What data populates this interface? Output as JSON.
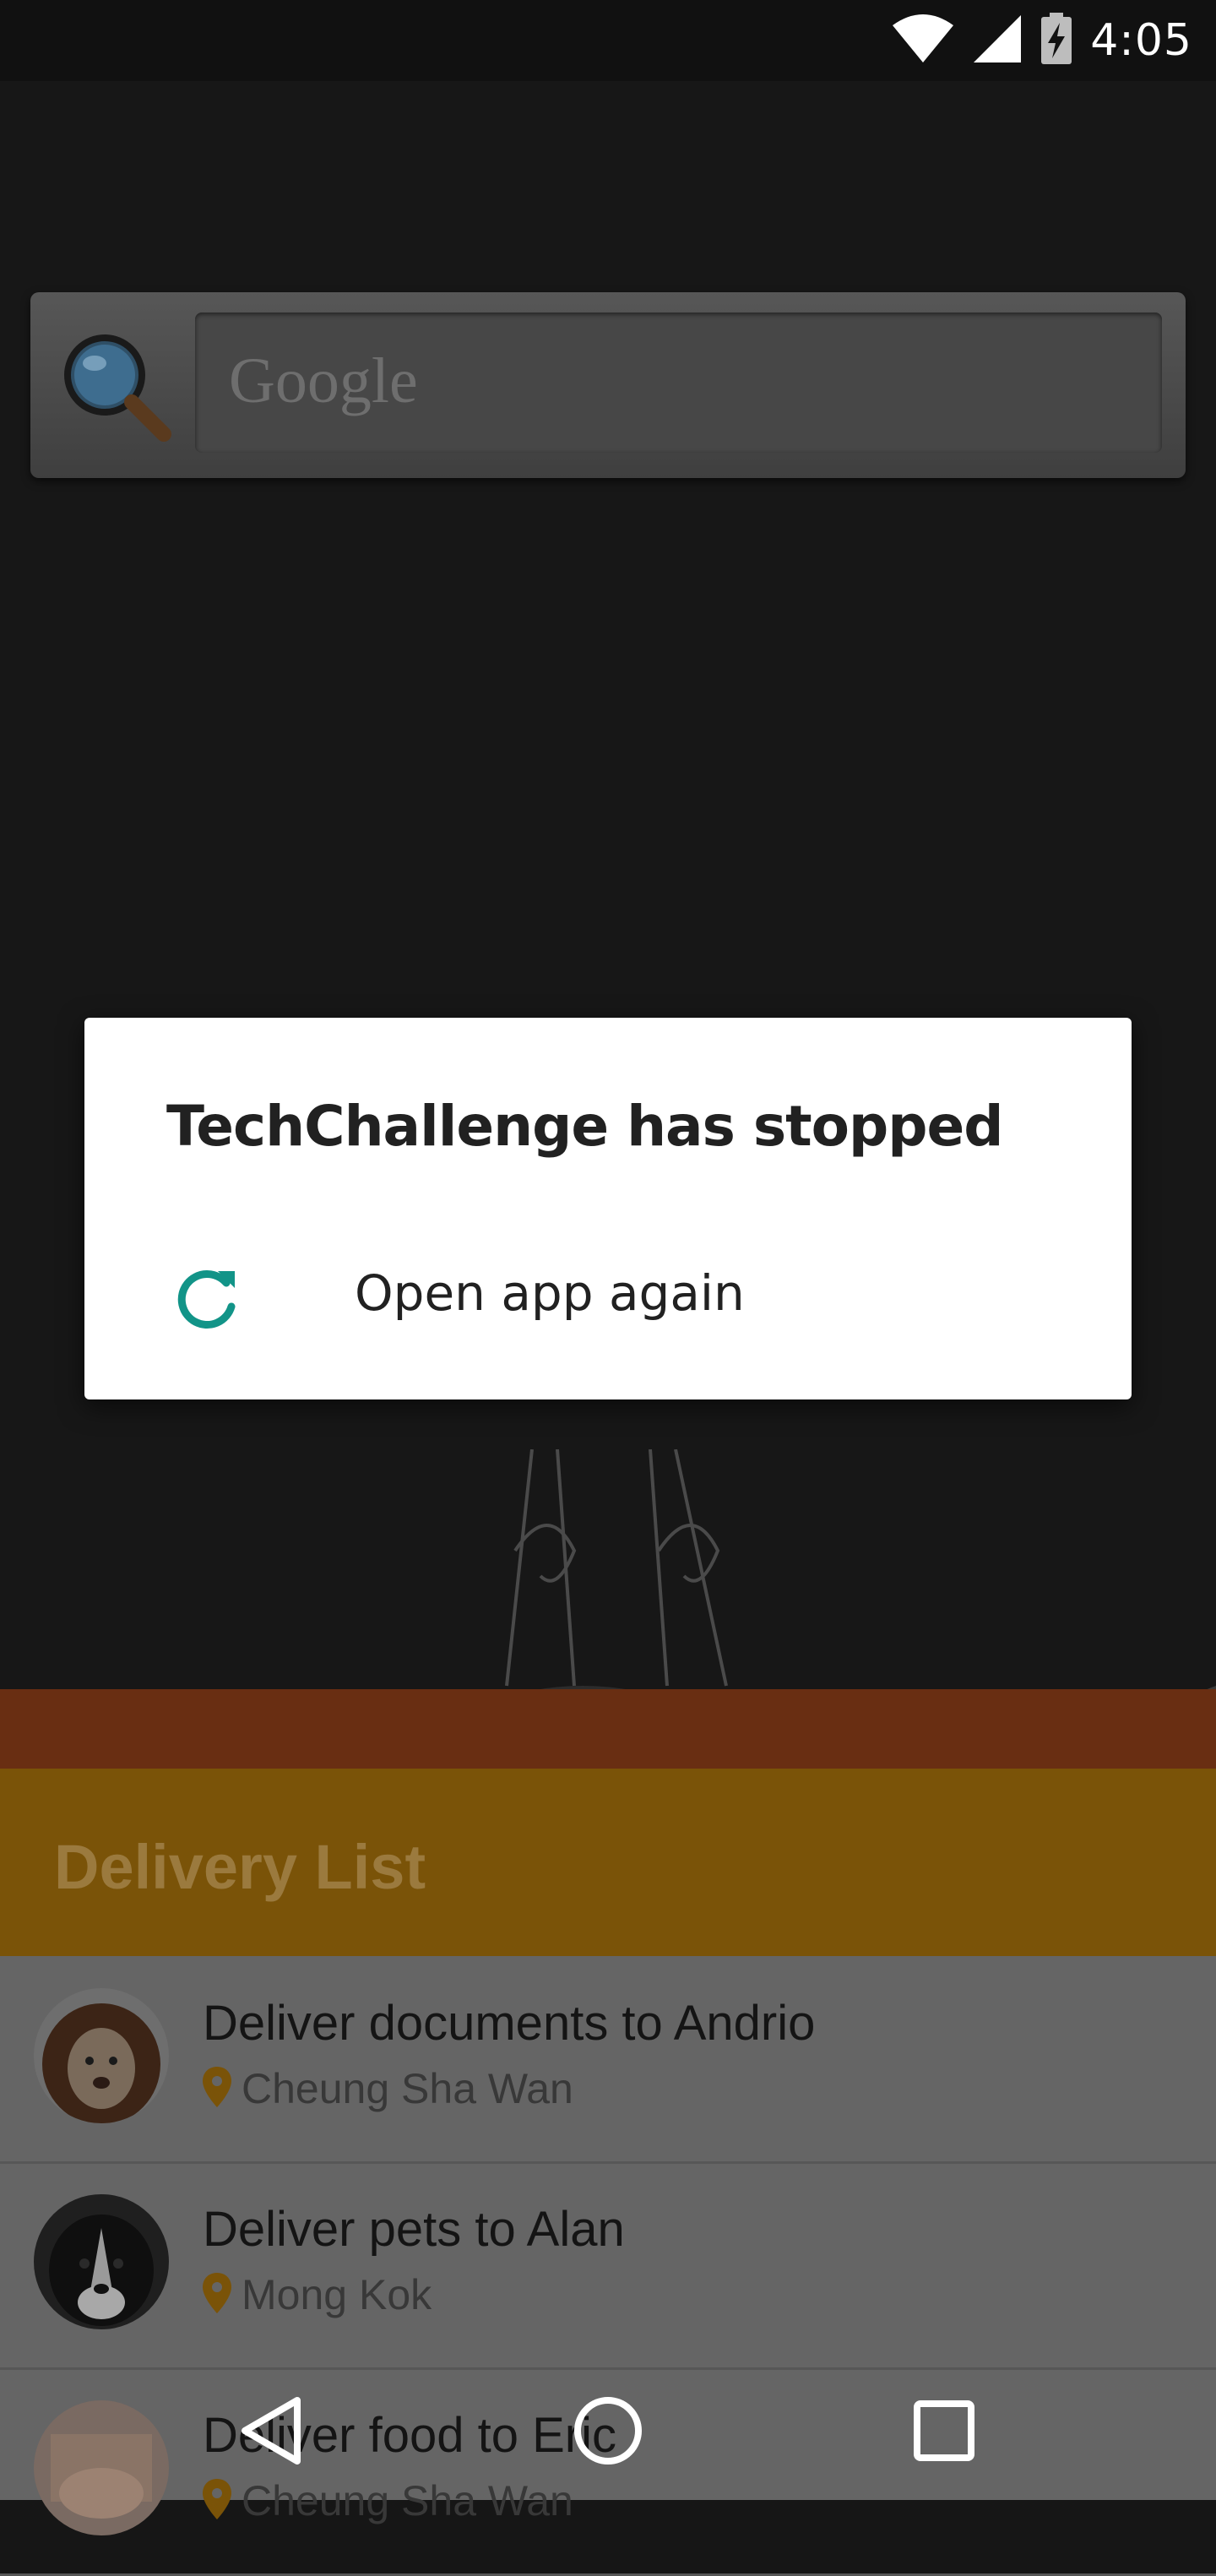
{
  "status_bar": {
    "time": "4:05",
    "icons": [
      "wifi-icon",
      "cell-signal-icon",
      "battery-charging-icon"
    ]
  },
  "launcher": {
    "search_placeholder": "Google"
  },
  "app": {
    "header_title": "Delivery List",
    "deliveries": [
      {
        "title": "Deliver documents to Andrio",
        "location": "Cheung Sha Wan"
      },
      {
        "title": "Deliver pets to Alan",
        "location": "Mong Kok"
      },
      {
        "title": "Deliver food to Eric",
        "location": "Cheung Sha Wan"
      }
    ]
  },
  "dialog": {
    "title": "TechChallenge has stopped",
    "action_label": "Open app again",
    "accent_color": "#129488"
  },
  "colors": {
    "app_primary": "#FF9800",
    "app_primary_dark": "#E65100"
  }
}
